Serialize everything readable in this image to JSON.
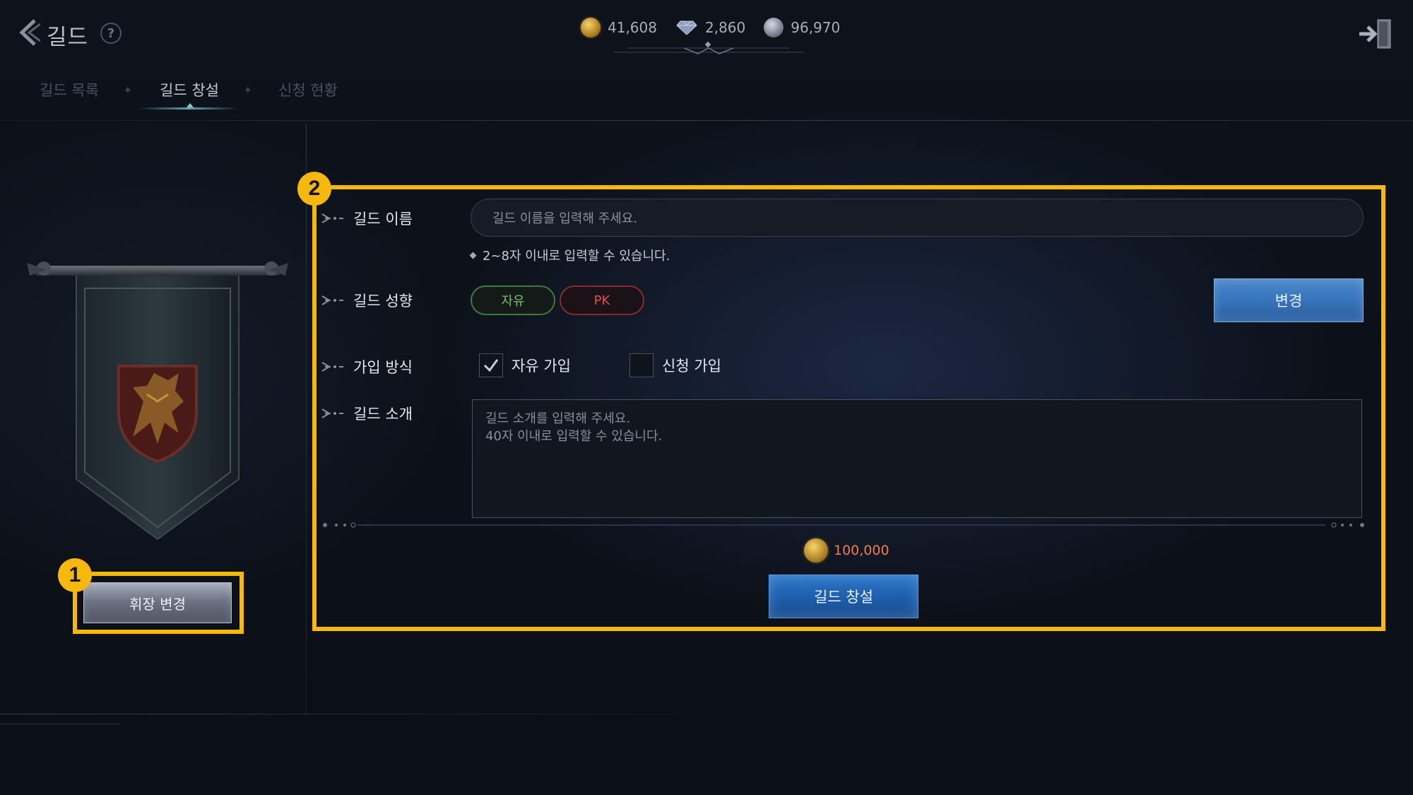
{
  "header": {
    "title": "길드",
    "help_label": "?"
  },
  "currency": [
    {
      "icon": "gold-coin-icon",
      "value": "41,608"
    },
    {
      "icon": "diamond-icon",
      "value": "2,860"
    },
    {
      "icon": "silver-coin-icon",
      "value": "96,970"
    }
  ],
  "tabs": [
    {
      "label": "길드 목록",
      "active": false
    },
    {
      "label": "길드 창설",
      "active": true
    },
    {
      "label": "신청 현황",
      "active": false
    }
  ],
  "left_panel": {
    "emblem_button": "휘장 변경"
  },
  "form": {
    "name_label": "길드 이름",
    "name_placeholder": "길드 이름을 입력해 주세요.",
    "name_hint": "2~8자 이내로 입력할 수 있습니다.",
    "tendency_label": "길드 성향",
    "tendency_options": [
      "자유",
      "PK"
    ],
    "change_button": "변경",
    "join_label": "가입 방식",
    "join_free": "자유 가입",
    "join_free_checked": true,
    "join_apply": "신청 가입",
    "join_apply_checked": false,
    "intro_label": "길드 소개",
    "intro_placeholder": "길드 소개를 입력해 주세요.\n40자 이내로 입력할 수 있습니다.",
    "cost": "100,000",
    "create_button": "길드 창설"
  },
  "annotations": {
    "badge1": "1",
    "badge2": "2",
    "highlight_color": "#f5b80b"
  }
}
